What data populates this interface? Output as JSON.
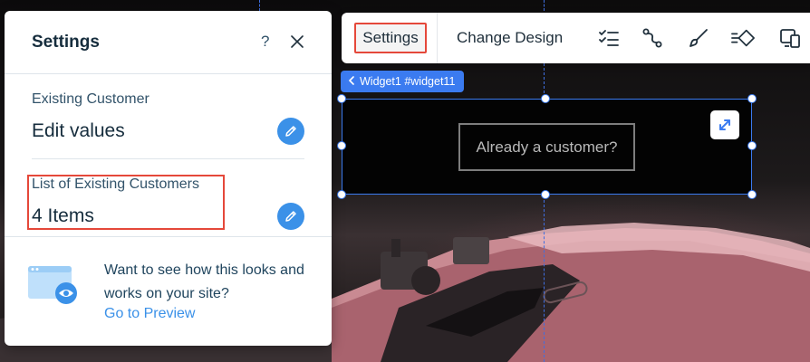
{
  "panel": {
    "title": "Settings",
    "help_label": "?",
    "close_icon": "close-icon",
    "field1": {
      "label": "Existing Customer",
      "value": "Edit values",
      "icon": "pencil-icon"
    },
    "field2": {
      "label": "List of Existing Customers",
      "value": "4 Items",
      "icon": "pencil-icon"
    },
    "promo": {
      "text": "Want to see how this looks and works on your site?",
      "link": "Go to Preview",
      "icon": "browser-preview-icon"
    }
  },
  "toolbar": {
    "settings_label": "Settings",
    "change_design_label": "Change Design",
    "icons": [
      "checklist-icon",
      "connect-icon",
      "brush-icon",
      "animation-icon",
      "devices-icon"
    ]
  },
  "chip": {
    "label": "Widget1 #widget11",
    "icon": "chevron-left-icon"
  },
  "widget": {
    "button_label": "Already a customer?",
    "stretch_icon": "expand-diagonal-icon"
  },
  "colors": {
    "accent_blue": "#3b7bf0",
    "edit_button_blue": "#3b91e8",
    "highlight_red": "#e5483a",
    "panel_text": "#162d3d"
  }
}
